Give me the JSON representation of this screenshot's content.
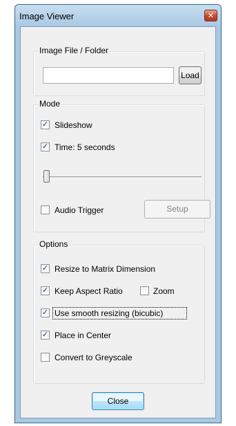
{
  "window": {
    "title": "Image Viewer",
    "close_glyph": "✕"
  },
  "file_group": {
    "legend": "Image File / Folder",
    "path_value": "",
    "load_label": "Load"
  },
  "mode_group": {
    "legend": "Mode",
    "slideshow": {
      "label": "Slideshow",
      "checked": true
    },
    "time": {
      "label": "Time: 5 seconds",
      "checked": true
    },
    "time_slider_level": 0.0,
    "audio_trigger": {
      "label": "Audio Trigger",
      "checked": false
    },
    "setup_label": "Setup"
  },
  "options_group": {
    "legend": "Options",
    "resize_matrix": {
      "label": "Resize to Matrix Dimension",
      "checked": true
    },
    "keep_aspect": {
      "label": "Keep Aspect Ratio",
      "checked": true
    },
    "zoom": {
      "label": "Zoom",
      "checked": false
    },
    "smooth_resize": {
      "label": "Use smooth resizing (bicubic)",
      "checked": true
    },
    "place_center": {
      "label": "Place in Center",
      "checked": true
    },
    "greyscale": {
      "label": "Convert to Greyscale",
      "checked": false
    }
  },
  "close_button_label": "Close",
  "check_glyph": "✓"
}
